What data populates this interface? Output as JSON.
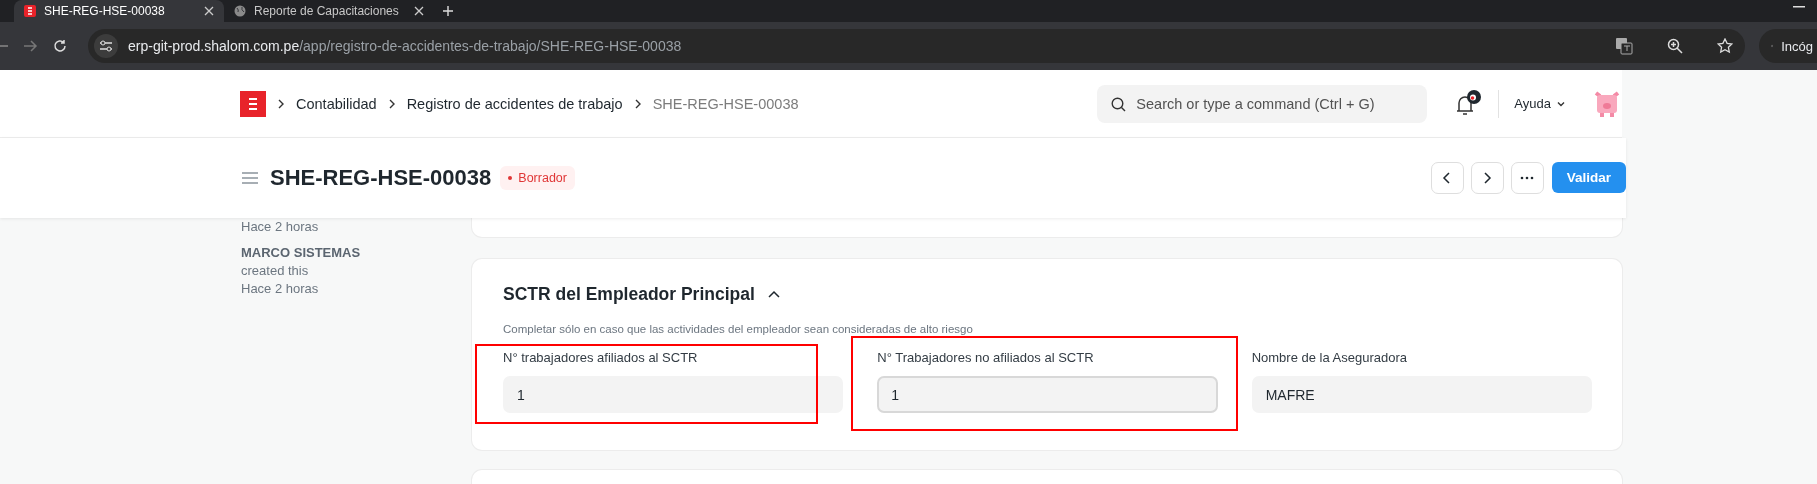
{
  "browser": {
    "tabs": [
      {
        "title": "SHE-REG-HSE-00038",
        "selected": true
      },
      {
        "title": "Reporte de Capacitaciones",
        "selected": false
      }
    ],
    "url_host": "erp-git-prod.shalom.com.pe",
    "url_path": "/app/registro-de-accidentes-de-trabajo/SHE-REG-HSE-00038",
    "profile_label": "Incóg"
  },
  "navbar": {
    "breadcrumbs": [
      {
        "label": "Contabilidad",
        "current": false
      },
      {
        "label": "Registro de accidentes de trabajo",
        "current": false
      },
      {
        "label": "SHE-REG-HSE-00038",
        "current": true
      }
    ],
    "search": {
      "placeholder": "Search or type a command (Ctrl + G)"
    },
    "help": "Ayuda"
  },
  "page_head": {
    "title": "SHE-REG-HSE-00038",
    "status": "Borrador",
    "primary_action": "Validar"
  },
  "timeline": [
    {
      "text": "Hace 2 horas"
    },
    {
      "text": "**MARCO SISTEMAS** created this"
    },
    {
      "text": "Hace 2 horas"
    }
  ],
  "section": {
    "title": "SCTR del Empleador Principal",
    "expanded": true,
    "description": "Completar sólo en caso que las actividades del empleador sean consideradas de alto riesgo",
    "fields": [
      {
        "label": "N° trabajadores afiliados al SCTR",
        "value": "1",
        "focused": false,
        "highlighted": true
      },
      {
        "label": "N° Trabajadores no afiliados al SCTR",
        "value": "1",
        "focused": true,
        "highlighted": true
      },
      {
        "label": "Nombre de la Aseguradora",
        "value": "MAFRE",
        "focused": false,
        "highlighted": false
      }
    ]
  }
}
